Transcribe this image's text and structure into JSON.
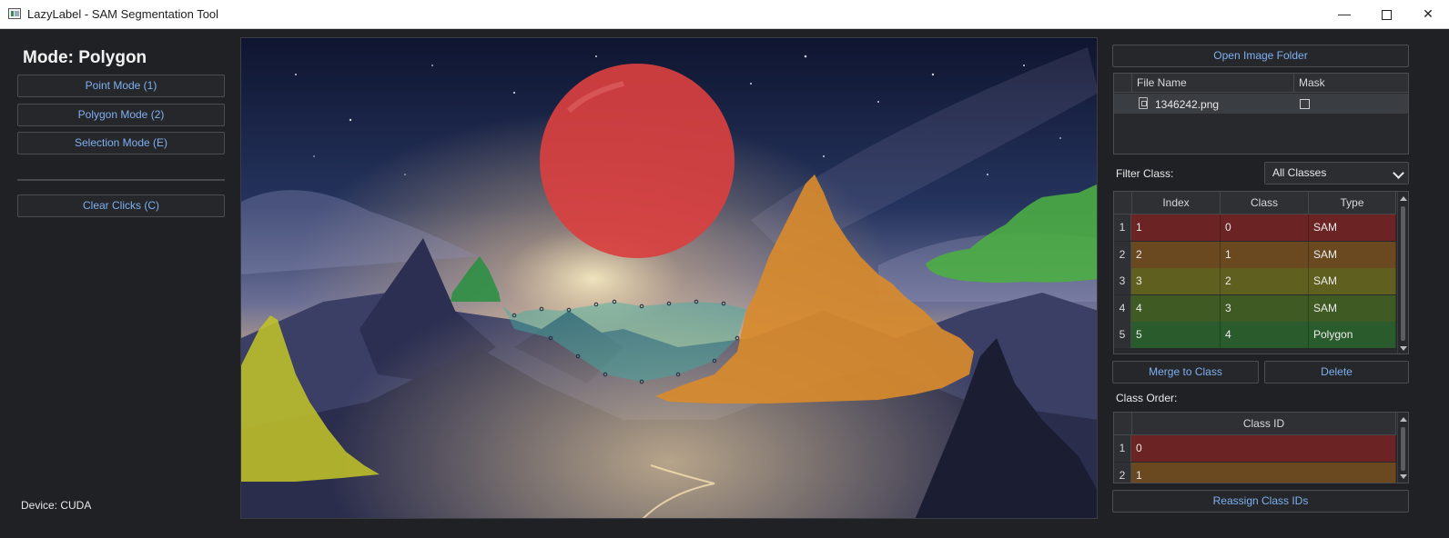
{
  "window": {
    "title": "LazyLabel - SAM Segmentation Tool",
    "minimize_glyph": "—",
    "close_glyph": "✕"
  },
  "left_panel": {
    "mode_title": "Mode: Polygon",
    "buttons": {
      "point_mode": "Point Mode (1)",
      "polygon_mode": "Polygon Mode (2)",
      "selection_mode": "Selection Mode (E)",
      "clear_clicks": "Clear Clicks (C)"
    },
    "device": "Device: CUDA"
  },
  "right_panel": {
    "open_folder": "Open Image Folder",
    "file_table": {
      "headers": {
        "name": "File Name",
        "mask": "Mask"
      },
      "rows": [
        {
          "name": "1346242.png",
          "mask": false
        }
      ]
    },
    "filter": {
      "label": "Filter Class:",
      "value": "All Classes"
    },
    "segments_table": {
      "headers": {
        "index": "Index",
        "class": "Class",
        "type": "Type"
      },
      "rows": [
        {
          "num": "1",
          "index": "1",
          "class": "0",
          "type": "SAM",
          "color": "#6b2323"
        },
        {
          "num": "2",
          "index": "2",
          "class": "1",
          "type": "SAM",
          "color": "#6a4921"
        },
        {
          "num": "3",
          "index": "3",
          "class": "2",
          "type": "SAM",
          "color": "#5f5f1f"
        },
        {
          "num": "4",
          "index": "4",
          "class": "3",
          "type": "SAM",
          "color": "#3f5a22"
        },
        {
          "num": "5",
          "index": "5",
          "class": "4",
          "type": "Polygon",
          "color": "#2a5b2c"
        }
      ]
    },
    "merge_button": "Merge to Class",
    "delete_button": "Delete",
    "class_order": {
      "label": "Class Order:",
      "header": "Class ID",
      "rows": [
        {
          "num": "1",
          "id": "0",
          "color": "#6b2323"
        },
        {
          "num": "2",
          "id": "1",
          "color": "#6a4921"
        }
      ]
    },
    "reassign_button": "Reassign Class IDs"
  },
  "colors": {
    "mask_red": "#d94040",
    "mask_orange": "#d88a2c",
    "mask_yellow": "#bfc229",
    "mask_green": "#4caf42",
    "mask_polygon_green": "#2e8f45",
    "mask_teal": "#3ab0a4",
    "link_blue": "#7fb0ef"
  }
}
